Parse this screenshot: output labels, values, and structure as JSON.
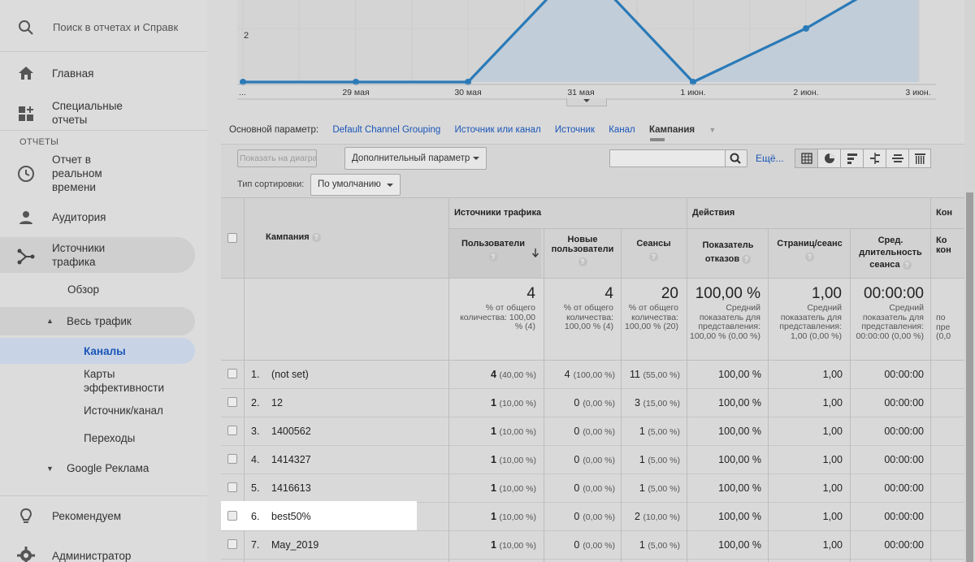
{
  "search": {
    "placeholder": "Поиск в отчетах и Справк"
  },
  "sidebar": {
    "home": "Главная",
    "special": "Специальные отчеты",
    "section": "ОТЧЕТЫ",
    "realtime": "Отчет в реальном времени",
    "audience": "Аудитория",
    "traffic": "Источники трафика",
    "overview": "Обзор",
    "all_traffic": "Весь трафик",
    "channels": "Каналы",
    "treemaps": "Карты эффективности",
    "source_medium": "Источник/канал",
    "referrals": "Переходы",
    "google_ads": "Google Реклама",
    "recommend": "Рекомендуем",
    "admin": "Администратор"
  },
  "chart_data": {
    "type": "area",
    "categories": [
      "...",
      "29 мая",
      "30 мая",
      "31 мая",
      "1 июн.",
      "2 июн.",
      "3 июн."
    ],
    "series": [
      {
        "values": [
          1,
          1,
          1,
          3,
          1,
          2,
          3
        ]
      }
    ],
    "ytick": "2",
    "color": "#2a7ab8"
  },
  "dimensions": {
    "label": "Основной параметр:",
    "items": [
      "Default Channel Grouping",
      "Источник или канал",
      "Источник",
      "Канал"
    ],
    "current": "Кампания"
  },
  "toolbar": {
    "plot_rows": "Показать на диаграмме",
    "secondary": "Дополнительный параметр",
    "more": "Ещё...",
    "sort_label": "Тип сортировки:",
    "sort_value": "По умолчанию"
  },
  "table": {
    "col_campaign": "Кампания",
    "group_acq": "Источники трафика",
    "group_beh": "Действия",
    "group_conv": "Кон",
    "h_users": "Пользователи",
    "h_new_users": "Новые пользователи",
    "h_sessions": "Сеансы",
    "h_bounce": "Показатель отказов",
    "h_pages": "Страниц/сеанс",
    "h_duration": "Сред. длительность сеанса",
    "h_conv": "Ко кон",
    "totals": {
      "users": "4",
      "users_sub": "% от общего количества: 100,00 % (4)",
      "new_users": "4",
      "new_users_sub": "% от общего количества: 100,00 % (4)",
      "sessions": "20",
      "sessions_sub": "% от общего количества: 100,00 % (20)",
      "bounce": "100,00 %",
      "bounce_sub": "Средний показатель для представления: 100,00 % (0,00 %)",
      "pages": "1,00",
      "pages_sub": "Средний показатель для представления: 1,00 (0,00 %)",
      "duration": "00:00:00",
      "duration_sub": "Средний показатель для представления: 00:00:00 (0,00 %)",
      "conv_sub": "по пре (0,0"
    },
    "rows": [
      {
        "idx": "1.",
        "name": "(not set)",
        "users": "4",
        "users_pct": "(40,00 %)",
        "new": "4",
        "new_pct": "(100,00 %)",
        "sess": "11",
        "sess_pct": "(55,00 %)",
        "bounce": "100,00 %",
        "pages": "1,00",
        "dur": "00:00:00"
      },
      {
        "idx": "2.",
        "name": "12",
        "users": "1",
        "users_pct": "(10,00 %)",
        "new": "0",
        "new_pct": "(0,00 %)",
        "sess": "3",
        "sess_pct": "(15,00 %)",
        "bounce": "100,00 %",
        "pages": "1,00",
        "dur": "00:00:00"
      },
      {
        "idx": "3.",
        "name": "1400562",
        "users": "1",
        "users_pct": "(10,00 %)",
        "new": "0",
        "new_pct": "(0,00 %)",
        "sess": "1",
        "sess_pct": "(5,00 %)",
        "bounce": "100,00 %",
        "pages": "1,00",
        "dur": "00:00:00"
      },
      {
        "idx": "4.",
        "name": "1414327",
        "users": "1",
        "users_pct": "(10,00 %)",
        "new": "0",
        "new_pct": "(0,00 %)",
        "sess": "1",
        "sess_pct": "(5,00 %)",
        "bounce": "100,00 %",
        "pages": "1,00",
        "dur": "00:00:00"
      },
      {
        "idx": "5.",
        "name": "1416613",
        "users": "1",
        "users_pct": "(10,00 %)",
        "new": "0",
        "new_pct": "(0,00 %)",
        "sess": "1",
        "sess_pct": "(5,00 %)",
        "bounce": "100,00 %",
        "pages": "1,00",
        "dur": "00:00:00"
      },
      {
        "idx": "6.",
        "name": "best50%",
        "users": "1",
        "users_pct": "(10,00 %)",
        "new": "0",
        "new_pct": "(0,00 %)",
        "sess": "2",
        "sess_pct": "(10,00 %)",
        "bounce": "100,00 %",
        "pages": "1,00",
        "dur": "00:00:00"
      },
      {
        "idx": "7.",
        "name": "May_2019",
        "users": "1",
        "users_pct": "(10,00 %)",
        "new": "0",
        "new_pct": "(0,00 %)",
        "sess": "1",
        "sess_pct": "(5,00 %)",
        "bounce": "100,00 %",
        "pages": "1,00",
        "dur": "00:00:00"
      }
    ]
  }
}
